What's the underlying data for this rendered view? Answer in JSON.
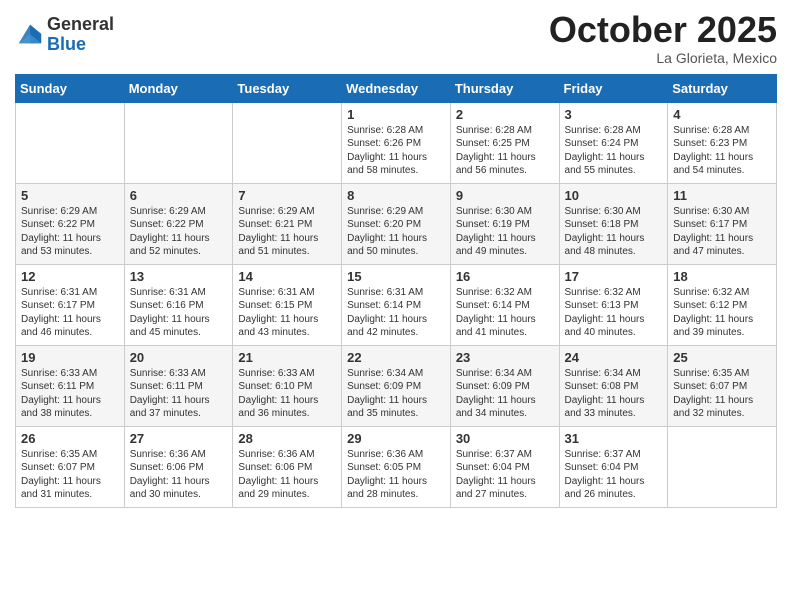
{
  "logo": {
    "general": "General",
    "blue": "Blue"
  },
  "header": {
    "month": "October 2025",
    "location": "La Glorieta, Mexico"
  },
  "weekdays": [
    "Sunday",
    "Monday",
    "Tuesday",
    "Wednesday",
    "Thursday",
    "Friday",
    "Saturday"
  ],
  "weeks": [
    [
      {
        "day": null,
        "sunrise": null,
        "sunset": null,
        "daylight": null
      },
      {
        "day": null,
        "sunrise": null,
        "sunset": null,
        "daylight": null
      },
      {
        "day": null,
        "sunrise": null,
        "sunset": null,
        "daylight": null
      },
      {
        "day": "1",
        "sunrise": "Sunrise: 6:28 AM",
        "sunset": "Sunset: 6:26 PM",
        "daylight": "Daylight: 11 hours and 58 minutes."
      },
      {
        "day": "2",
        "sunrise": "Sunrise: 6:28 AM",
        "sunset": "Sunset: 6:25 PM",
        "daylight": "Daylight: 11 hours and 56 minutes."
      },
      {
        "day": "3",
        "sunrise": "Sunrise: 6:28 AM",
        "sunset": "Sunset: 6:24 PM",
        "daylight": "Daylight: 11 hours and 55 minutes."
      },
      {
        "day": "4",
        "sunrise": "Sunrise: 6:28 AM",
        "sunset": "Sunset: 6:23 PM",
        "daylight": "Daylight: 11 hours and 54 minutes."
      }
    ],
    [
      {
        "day": "5",
        "sunrise": "Sunrise: 6:29 AM",
        "sunset": "Sunset: 6:22 PM",
        "daylight": "Daylight: 11 hours and 53 minutes."
      },
      {
        "day": "6",
        "sunrise": "Sunrise: 6:29 AM",
        "sunset": "Sunset: 6:22 PM",
        "daylight": "Daylight: 11 hours and 52 minutes."
      },
      {
        "day": "7",
        "sunrise": "Sunrise: 6:29 AM",
        "sunset": "Sunset: 6:21 PM",
        "daylight": "Daylight: 11 hours and 51 minutes."
      },
      {
        "day": "8",
        "sunrise": "Sunrise: 6:29 AM",
        "sunset": "Sunset: 6:20 PM",
        "daylight": "Daylight: 11 hours and 50 minutes."
      },
      {
        "day": "9",
        "sunrise": "Sunrise: 6:30 AM",
        "sunset": "Sunset: 6:19 PM",
        "daylight": "Daylight: 11 hours and 49 minutes."
      },
      {
        "day": "10",
        "sunrise": "Sunrise: 6:30 AM",
        "sunset": "Sunset: 6:18 PM",
        "daylight": "Daylight: 11 hours and 48 minutes."
      },
      {
        "day": "11",
        "sunrise": "Sunrise: 6:30 AM",
        "sunset": "Sunset: 6:17 PM",
        "daylight": "Daylight: 11 hours and 47 minutes."
      }
    ],
    [
      {
        "day": "12",
        "sunrise": "Sunrise: 6:31 AM",
        "sunset": "Sunset: 6:17 PM",
        "daylight": "Daylight: 11 hours and 46 minutes."
      },
      {
        "day": "13",
        "sunrise": "Sunrise: 6:31 AM",
        "sunset": "Sunset: 6:16 PM",
        "daylight": "Daylight: 11 hours and 45 minutes."
      },
      {
        "day": "14",
        "sunrise": "Sunrise: 6:31 AM",
        "sunset": "Sunset: 6:15 PM",
        "daylight": "Daylight: 11 hours and 43 minutes."
      },
      {
        "day": "15",
        "sunrise": "Sunrise: 6:31 AM",
        "sunset": "Sunset: 6:14 PM",
        "daylight": "Daylight: 11 hours and 42 minutes."
      },
      {
        "day": "16",
        "sunrise": "Sunrise: 6:32 AM",
        "sunset": "Sunset: 6:14 PM",
        "daylight": "Daylight: 11 hours and 41 minutes."
      },
      {
        "day": "17",
        "sunrise": "Sunrise: 6:32 AM",
        "sunset": "Sunset: 6:13 PM",
        "daylight": "Daylight: 11 hours and 40 minutes."
      },
      {
        "day": "18",
        "sunrise": "Sunrise: 6:32 AM",
        "sunset": "Sunset: 6:12 PM",
        "daylight": "Daylight: 11 hours and 39 minutes."
      }
    ],
    [
      {
        "day": "19",
        "sunrise": "Sunrise: 6:33 AM",
        "sunset": "Sunset: 6:11 PM",
        "daylight": "Daylight: 11 hours and 38 minutes."
      },
      {
        "day": "20",
        "sunrise": "Sunrise: 6:33 AM",
        "sunset": "Sunset: 6:11 PM",
        "daylight": "Daylight: 11 hours and 37 minutes."
      },
      {
        "day": "21",
        "sunrise": "Sunrise: 6:33 AM",
        "sunset": "Sunset: 6:10 PM",
        "daylight": "Daylight: 11 hours and 36 minutes."
      },
      {
        "day": "22",
        "sunrise": "Sunrise: 6:34 AM",
        "sunset": "Sunset: 6:09 PM",
        "daylight": "Daylight: 11 hours and 35 minutes."
      },
      {
        "day": "23",
        "sunrise": "Sunrise: 6:34 AM",
        "sunset": "Sunset: 6:09 PM",
        "daylight": "Daylight: 11 hours and 34 minutes."
      },
      {
        "day": "24",
        "sunrise": "Sunrise: 6:34 AM",
        "sunset": "Sunset: 6:08 PM",
        "daylight": "Daylight: 11 hours and 33 minutes."
      },
      {
        "day": "25",
        "sunrise": "Sunrise: 6:35 AM",
        "sunset": "Sunset: 6:07 PM",
        "daylight": "Daylight: 11 hours and 32 minutes."
      }
    ],
    [
      {
        "day": "26",
        "sunrise": "Sunrise: 6:35 AM",
        "sunset": "Sunset: 6:07 PM",
        "daylight": "Daylight: 11 hours and 31 minutes."
      },
      {
        "day": "27",
        "sunrise": "Sunrise: 6:36 AM",
        "sunset": "Sunset: 6:06 PM",
        "daylight": "Daylight: 11 hours and 30 minutes."
      },
      {
        "day": "28",
        "sunrise": "Sunrise: 6:36 AM",
        "sunset": "Sunset: 6:06 PM",
        "daylight": "Daylight: 11 hours and 29 minutes."
      },
      {
        "day": "29",
        "sunrise": "Sunrise: 6:36 AM",
        "sunset": "Sunset: 6:05 PM",
        "daylight": "Daylight: 11 hours and 28 minutes."
      },
      {
        "day": "30",
        "sunrise": "Sunrise: 6:37 AM",
        "sunset": "Sunset: 6:04 PM",
        "daylight": "Daylight: 11 hours and 27 minutes."
      },
      {
        "day": "31",
        "sunrise": "Sunrise: 6:37 AM",
        "sunset": "Sunset: 6:04 PM",
        "daylight": "Daylight: 11 hours and 26 minutes."
      },
      {
        "day": null,
        "sunrise": null,
        "sunset": null,
        "daylight": null
      }
    ]
  ]
}
